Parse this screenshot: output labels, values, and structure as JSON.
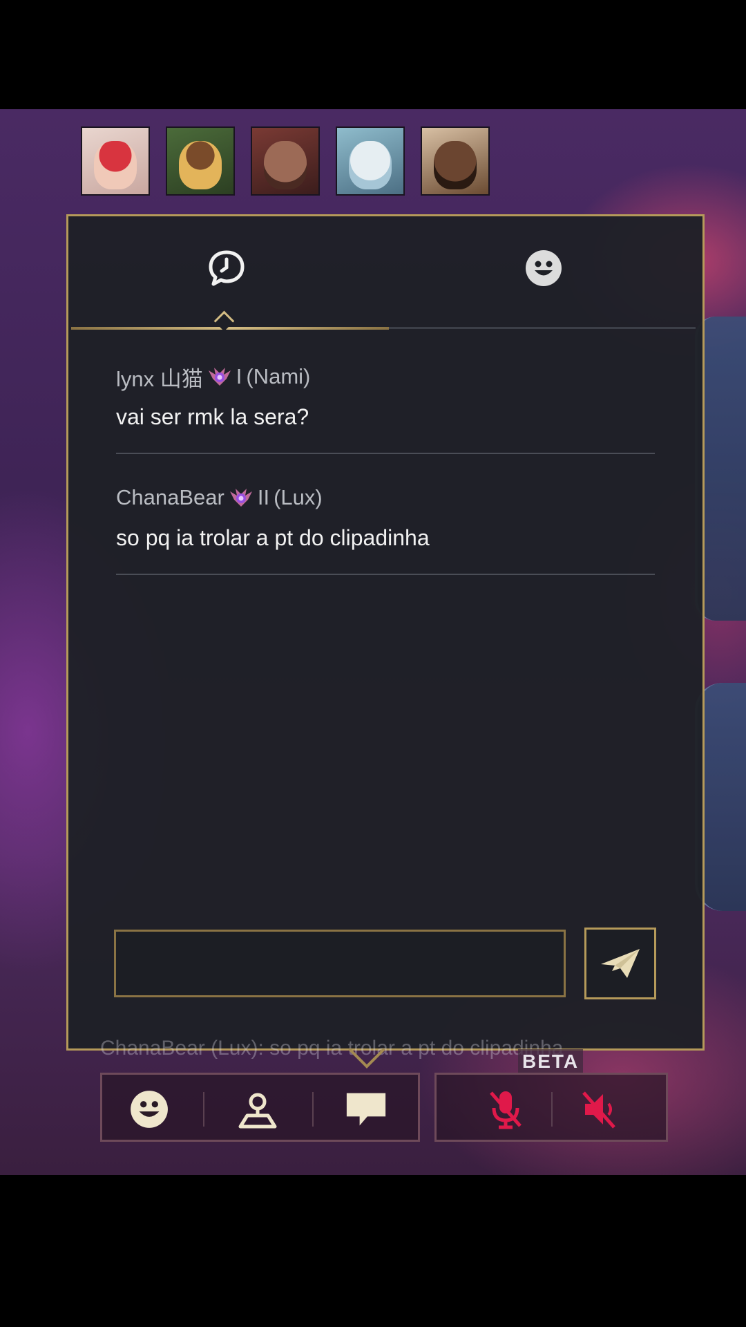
{
  "tabs": {
    "chat_icon": "chat-bubble-clock-icon",
    "emote_icon": "smiley-icon",
    "active": "chat"
  },
  "messages": [
    {
      "sender": "lynx 山猫",
      "rank_icon": "rank-emblem-icon",
      "rank": "I",
      "champion": "(Nami)",
      "text": "vai ser rmk la sera?"
    },
    {
      "sender": "ChanaBear",
      "rank_icon": "rank-emblem-icon",
      "rank": "II",
      "champion": "(Lux)",
      "text": "so pq ia trolar a pt do clipadinha"
    }
  ],
  "input": {
    "value": "",
    "placeholder": ""
  },
  "send_icon": "paper-plane-icon",
  "background_preview": "ChanaBear (Lux): so pq ia trolar a pt do clipadinha",
  "bottom_bar": {
    "left_buttons": [
      "emote-icon",
      "ping-location-icon",
      "chat-icon"
    ],
    "right_buttons": [
      "mic-muted-icon",
      "speaker-muted-icon"
    ],
    "beta_label": "BETA"
  },
  "colors": {
    "gold": "#b59a5a",
    "gold_light": "#d4bd84",
    "panel": "#1e2026",
    "muted_red": "#e0194a",
    "text": "#f1f1f1",
    "subtext": "#b9bcc2"
  }
}
